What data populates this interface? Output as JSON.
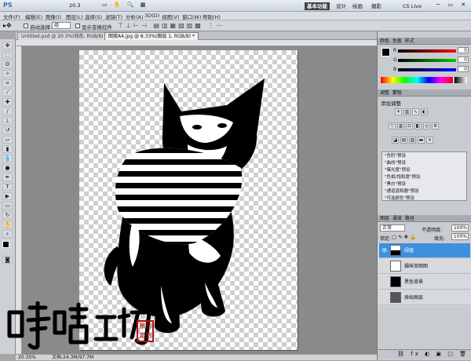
{
  "app": {
    "logo": "PS",
    "zoom_display": "20.3",
    "workspaces": [
      "基本功能",
      "设计",
      "绘画",
      "摄影"
    ],
    "cs_live": "CS Live"
  },
  "menu": [
    "文件(F)",
    "编辑(E)",
    "图像(I)",
    "图层(L)",
    "选择(S)",
    "滤镜(T)",
    "分析(A)",
    "3D(D)",
    "视图(V)",
    "窗口(W)",
    "帮助(H)"
  ],
  "options": {
    "auto_select_label": "自动选择:",
    "auto_select_value": "组",
    "show_transform_label": "显示变换控件"
  },
  "tabs": [
    "Untitled.psd @ 20.3%(纯色, RGB/8) *",
    "图案A4.jpg @ 8.33%(图层 1, RGB/8) *"
  ],
  "status": {
    "zoom": "20.35%",
    "doc": "文档:24.3M/97.7M"
  },
  "panels": {
    "color_tab": "颜色",
    "swatch_tab": "色板",
    "style_tab": "样式",
    "sliders": [
      {
        "label": "R",
        "value": "0",
        "color": "#d33"
      },
      {
        "label": "G",
        "value": "0",
        "color": "#3a3"
      },
      {
        "label": "B",
        "value": "0",
        "color": "#33d"
      }
    ],
    "adjust_tab": "调整",
    "mask_tab": "蒙版",
    "adjust_title": "添加调整",
    "presets": [
      "\"色阶\"预设",
      "\"曲线\"预设",
      "\"曝光度\"预设",
      "\"色相/饱和度\"预设",
      "\"黑白\"预设",
      "\"通道混和器\"预设",
      "\"可选颜色\"预设"
    ],
    "layers_tab": "图层",
    "channels_tab": "通道",
    "paths_tab": "路径",
    "blend_mode": "正常",
    "opacity_label": "不透明度:",
    "opacity": "100%",
    "lock_label": "锁定:",
    "fill_label": "填充:",
    "fill": "100%",
    "layers": [
      {
        "name": "阈值",
        "selected": true
      },
      {
        "name": "猫咪单图图",
        "selected": false
      },
      {
        "name": "黑色背景",
        "selected": false
      },
      {
        "name": "原始图层",
        "selected": false
      }
    ]
  },
  "watermark": {
    "text": "呼噜工坊",
    "seal": "原创定制"
  },
  "icons": [
    "move-tool-icon",
    "marquee-icon",
    "lasso-icon",
    "magic-wand-icon",
    "crop-icon",
    "eyedropper-icon",
    "brush-icon",
    "stamp-icon",
    "eraser-icon",
    "gradient-icon",
    "pen-icon",
    "type-icon",
    "hand-icon",
    "zoom-icon"
  ]
}
